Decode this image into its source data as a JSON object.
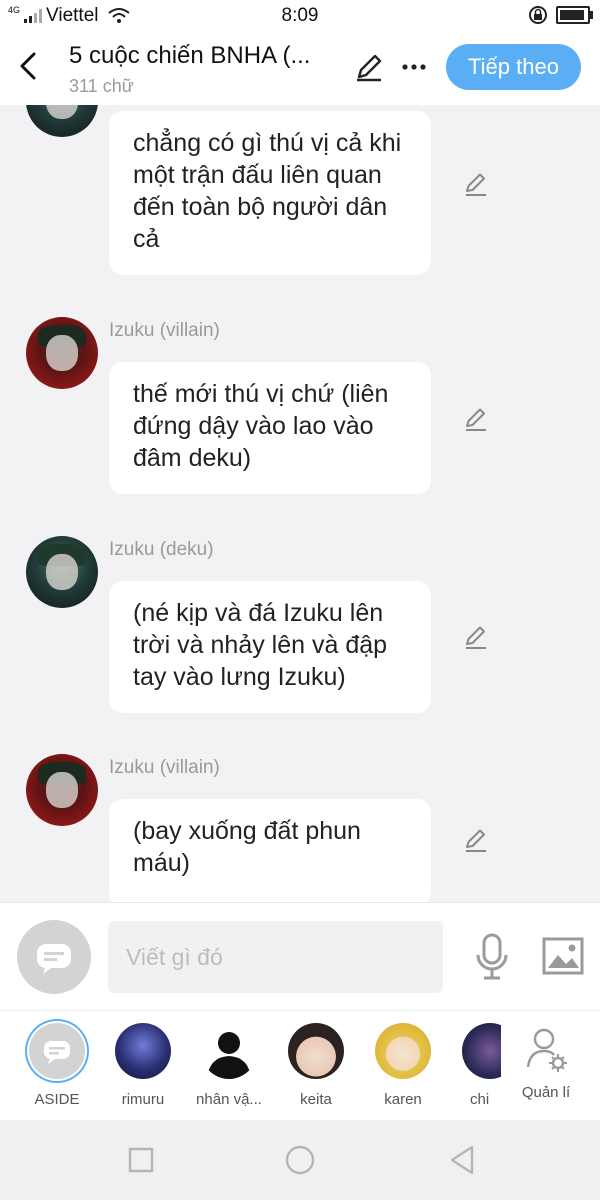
{
  "status_bar": {
    "network_tag": "4G",
    "carrier": "Viettel",
    "time": "8:09"
  },
  "header": {
    "title": "5 cuộc chiến BNHA (...",
    "subtitle": "311 chữ",
    "next_label": "Tiếp theo"
  },
  "messages": [
    {
      "sender": "",
      "text": "chẳng có gì thú vị cả khi một trận đấu liên quan đến toàn bộ người dân cả"
    },
    {
      "sender": "Izuku (villain)",
      "text": "thế mới thú vị chứ (liên đứng dậy vào lao vào đâm deku)"
    },
    {
      "sender": "Izuku (deku)",
      "text": "(né kịp và đá Izuku lên trời và nhảy lên và đập tay vào lưng Izuku)"
    },
    {
      "sender": "Izuku (villain)",
      "text": "(bay xuống đất phun máu)"
    }
  ],
  "composer": {
    "placeholder": "Viết gì đó"
  },
  "characters": [
    {
      "label": "ASIDE"
    },
    {
      "label": "rimuru"
    },
    {
      "label": "nhân vậ..."
    },
    {
      "label": "keita"
    },
    {
      "label": "karen"
    },
    {
      "label": "chi"
    },
    {
      "label": "Quản lí"
    }
  ],
  "colors": {
    "accent": "#5aaef4",
    "background": "#f2f2f4",
    "bubble": "#ffffff",
    "muted_text": "#9a9a9a"
  },
  "icons": {
    "back": "chevron-left-icon",
    "edit": "pencil-icon",
    "more": "more-horizontal-icon",
    "mic": "microphone-icon",
    "image": "image-icon",
    "manage": "user-settings-icon"
  }
}
